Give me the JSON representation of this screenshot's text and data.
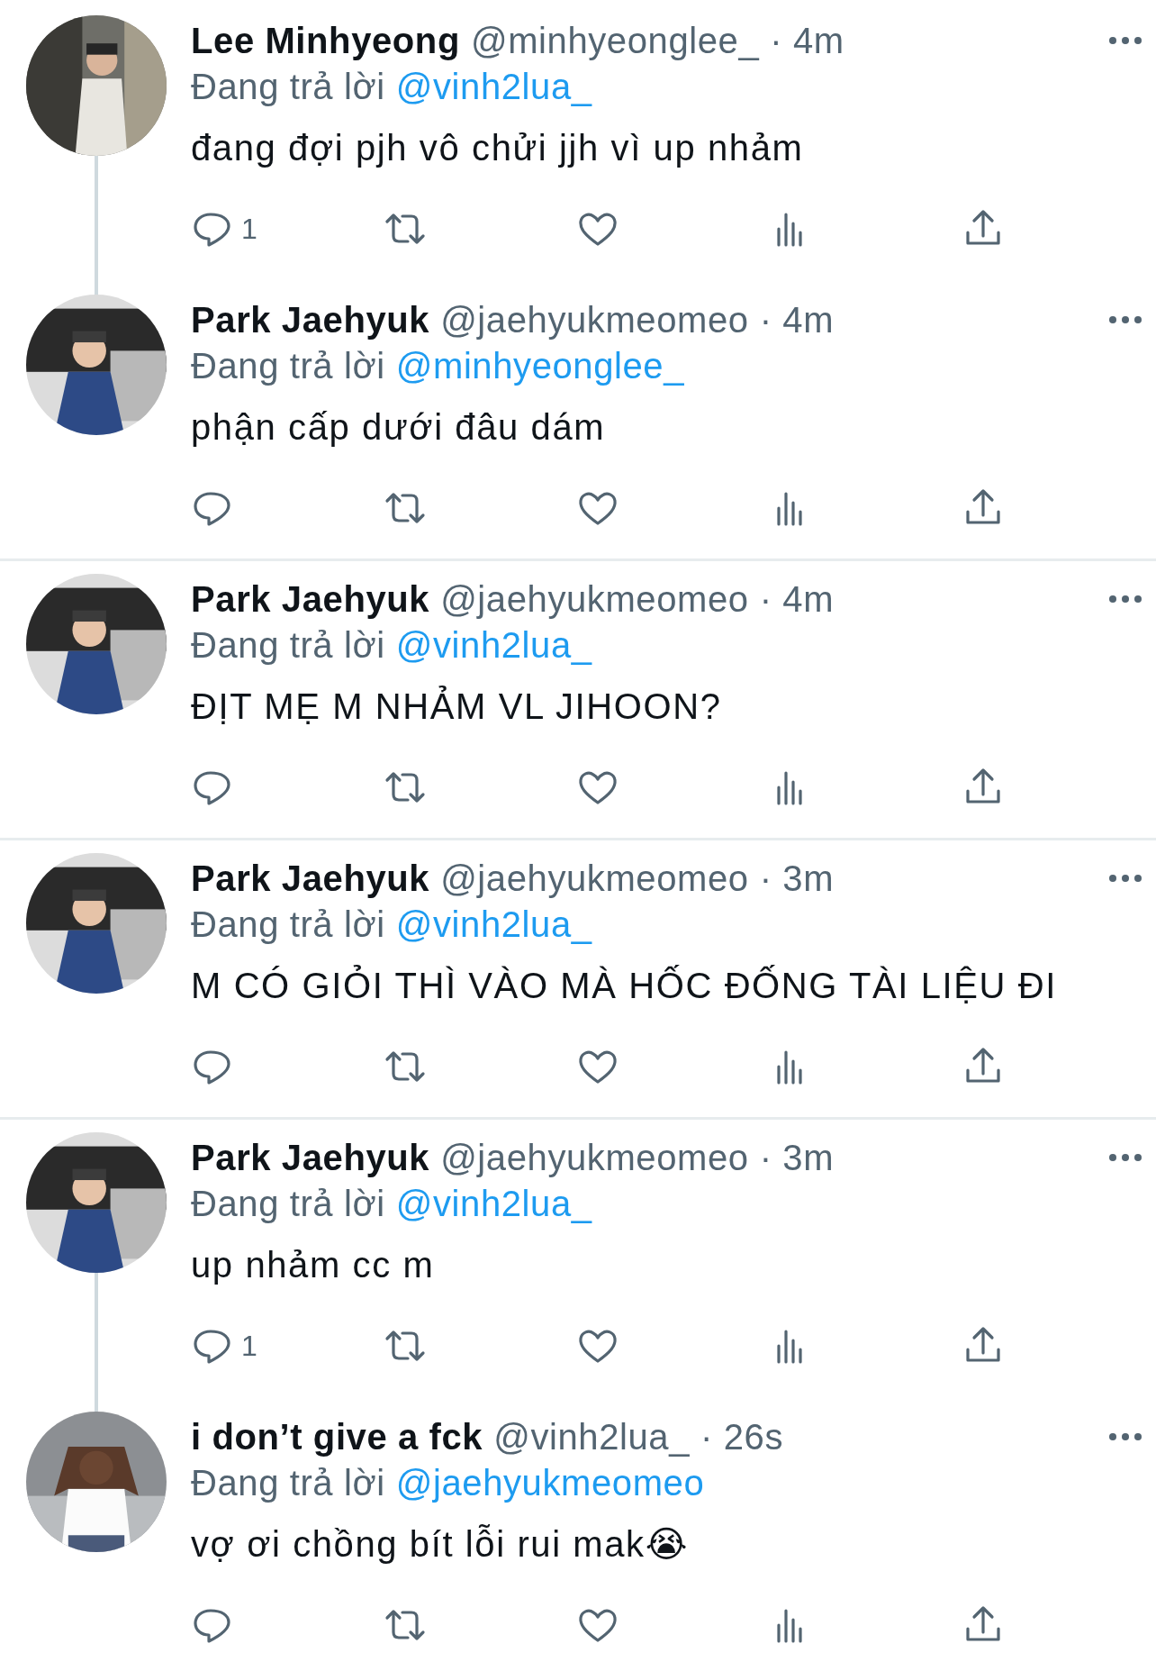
{
  "tweets": [
    {
      "name": "Lee Minhyeong",
      "handle": "@minhyeonglee_",
      "time": "· 4m",
      "reply_prefix": "Đang trả lời",
      "reply_to": "@vinh2lua_",
      "text": "đang đợi pjh vô chửi jjh vì up nhảm",
      "reply_count": "1",
      "thread_to_next": true
    },
    {
      "name": "Park Jaehyuk",
      "handle": "@jaehyukmeomeo",
      "time": "· 4m",
      "reply_prefix": "Đang trả lời",
      "reply_to": "@minhyeonglee_",
      "text": "phận cấp dưới đâu dám",
      "thread_to_next": false
    },
    {
      "name": "Park Jaehyuk",
      "handle": "@jaehyukmeomeo",
      "time": "· 4m",
      "reply_prefix": "Đang trả lời",
      "reply_to": "@vinh2lua_",
      "text": "ĐỊT MẸ M NHẢM VL JIHOON?",
      "thread_to_next": false
    },
    {
      "name": "Park Jaehyuk",
      "handle": "@jaehyukmeomeo",
      "time": "· 3m",
      "reply_prefix": "Đang trả lời",
      "reply_to": "@vinh2lua_",
      "text": "M CÓ GIỎI THÌ VÀO MÀ HỐC ĐỐNG TÀI LIỆU ĐI",
      "thread_to_next": false
    },
    {
      "name": "Park Jaehyuk",
      "handle": "@jaehyukmeomeo",
      "time": "· 3m",
      "reply_prefix": "Đang trả lời",
      "reply_to": "@vinh2lua_",
      "text": "up nhảm cc m",
      "reply_count": "1",
      "thread_to_next": true
    },
    {
      "name": "i don’t give a fck",
      "handle": "@vinh2lua_",
      "time": "· 26s",
      "reply_prefix": "Đang trả lời",
      "reply_to": "@jaehyukmeomeo",
      "text": "vợ ơi chồng bít lỗi rui mak😭",
      "thread_to_next": false
    }
  ]
}
